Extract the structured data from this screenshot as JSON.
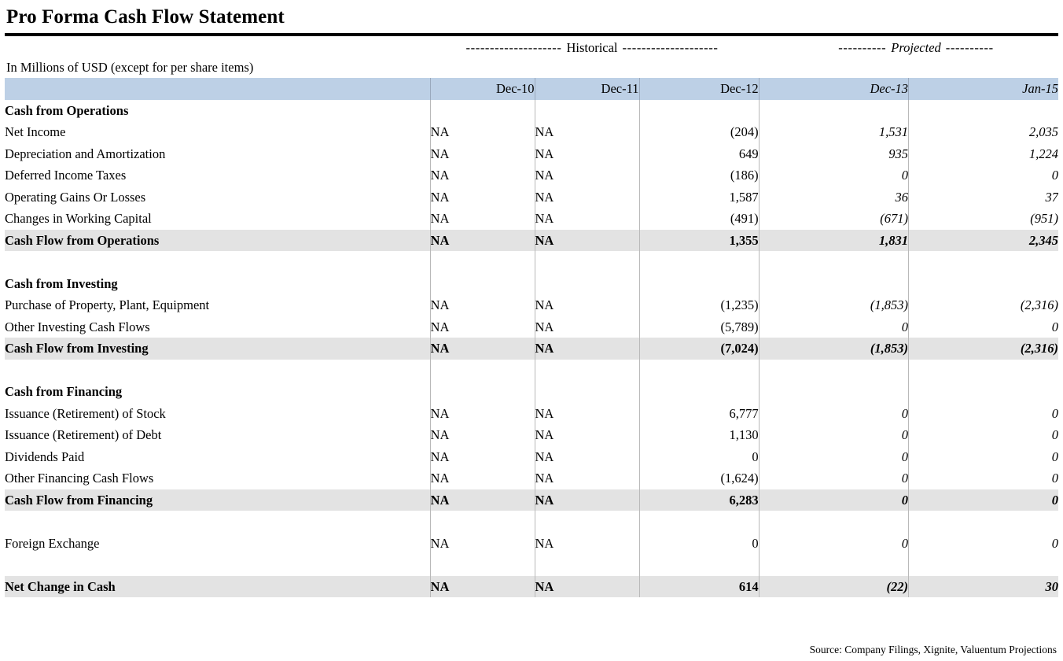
{
  "title": "Pro Forma Cash Flow Statement",
  "subtitle": "In Millions of USD (except for per share items)",
  "period_band": {
    "historical": {
      "dash_left": "--------------------",
      "label": "Historical",
      "dash_right": "--------------------"
    },
    "projected": {
      "dash_left": "----------",
      "label": "Projected",
      "dash_right": "----------"
    }
  },
  "colors": {
    "header_band": "#bdd0e6",
    "subtotal_band": "#e3e3e3",
    "rule": "#000000",
    "grid_line": "#b9b9b9"
  },
  "table": {
    "columns": [
      {
        "key": "label",
        "label": "",
        "align": "left",
        "italic": false
      },
      {
        "key": "dec10",
        "label": "Dec-10",
        "align": "right",
        "italic": false
      },
      {
        "key": "dec11",
        "label": "Dec-11",
        "align": "right",
        "italic": false
      },
      {
        "key": "dec12",
        "label": "Dec-12",
        "align": "right",
        "italic": false
      },
      {
        "key": "dec13",
        "label": "Dec-13",
        "align": "right",
        "italic": true
      },
      {
        "key": "jan15",
        "label": "Jan-15",
        "align": "right",
        "italic": true
      }
    ],
    "rows": [
      {
        "type": "section",
        "label": "Cash from Operations",
        "values": [
          "",
          "",
          "",
          "",
          ""
        ]
      },
      {
        "type": "item",
        "label": "Net Income",
        "values": [
          "NA",
          "NA",
          "(204)",
          "1,531",
          "2,035"
        ]
      },
      {
        "type": "item",
        "label": "Depreciation and Amortization",
        "values": [
          "NA",
          "NA",
          "649",
          "935",
          "1,224"
        ]
      },
      {
        "type": "item",
        "label": "Deferred Income Taxes",
        "values": [
          "NA",
          "NA",
          "(186)",
          "0",
          "0"
        ]
      },
      {
        "type": "item",
        "label": "Operating Gains Or Losses",
        "values": [
          "NA",
          "NA",
          "1,587",
          "36",
          "37"
        ]
      },
      {
        "type": "item",
        "label": "Changes in Working Capital",
        "values": [
          "NA",
          "NA",
          "(491)",
          "(671)",
          "(951)"
        ]
      },
      {
        "type": "subtotal",
        "label": "Cash Flow from Operations",
        "values": [
          "NA",
          "NA",
          "1,355",
          "1,831",
          "2,345"
        ]
      },
      {
        "type": "spacer",
        "label": "",
        "values": [
          "",
          "",
          "",
          "",
          ""
        ]
      },
      {
        "type": "section",
        "label": "Cash from Investing",
        "values": [
          "",
          "",
          "",
          "",
          ""
        ]
      },
      {
        "type": "item",
        "label": "Purchase of Property, Plant, Equipment",
        "values": [
          "NA",
          "NA",
          "(1,235)",
          "(1,853)",
          "(2,316)"
        ]
      },
      {
        "type": "item",
        "label": "Other Investing Cash Flows",
        "values": [
          "NA",
          "NA",
          "(5,789)",
          "0",
          "0"
        ]
      },
      {
        "type": "subtotal",
        "label": "Cash Flow from Investing",
        "values": [
          "NA",
          "NA",
          "(7,024)",
          "(1,853)",
          "(2,316)"
        ]
      },
      {
        "type": "spacer",
        "label": "",
        "values": [
          "",
          "",
          "",
          "",
          ""
        ]
      },
      {
        "type": "section",
        "label": "Cash from Financing",
        "values": [
          "",
          "",
          "",
          "",
          ""
        ]
      },
      {
        "type": "item",
        "label": "Issuance (Retirement) of Stock",
        "values": [
          "NA",
          "NA",
          "6,777",
          "0",
          "0"
        ]
      },
      {
        "type": "item",
        "label": "Issuance (Retirement) of Debt",
        "values": [
          "NA",
          "NA",
          "1,130",
          "0",
          "0"
        ]
      },
      {
        "type": "item",
        "label": "Dividends Paid",
        "values": [
          "NA",
          "NA",
          "0",
          "0",
          "0"
        ]
      },
      {
        "type": "item",
        "label": "Other Financing Cash Flows",
        "values": [
          "NA",
          "NA",
          "(1,624)",
          "0",
          "0"
        ]
      },
      {
        "type": "subtotal",
        "label": "Cash Flow from Financing",
        "values": [
          "NA",
          "NA",
          "6,283",
          "0",
          "0"
        ]
      },
      {
        "type": "spacer",
        "label": "",
        "values": [
          "",
          "",
          "",
          "",
          ""
        ]
      },
      {
        "type": "item",
        "label": "Foreign Exchange",
        "values": [
          "NA",
          "NA",
          "0",
          "0",
          "0"
        ]
      },
      {
        "type": "spacer-tall",
        "label": "",
        "values": [
          "",
          "",
          "",
          "",
          ""
        ]
      },
      {
        "type": "subtotal",
        "label": "Net Change in Cash",
        "values": [
          "NA",
          "NA",
          "614",
          "(22)",
          "30"
        ]
      }
    ]
  },
  "source_note": "Source: Company Filings, Xignite, Valuentum Projections"
}
